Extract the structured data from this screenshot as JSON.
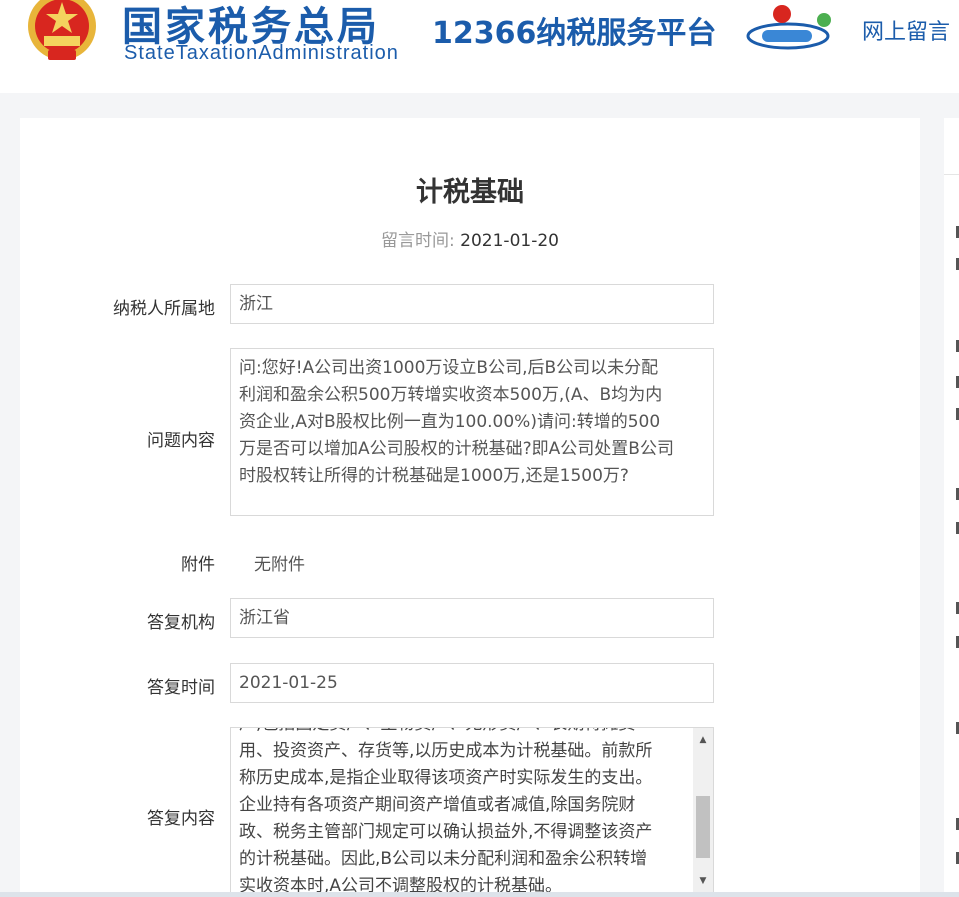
{
  "header": {
    "brand_cn": "国家税务总局",
    "brand_en": "StateTaxationAdministration",
    "platform": "12366纳税服务平台",
    "nav_link": "网上留言",
    "brand_color": "#1b5cab"
  },
  "page": {
    "title": "计税基础",
    "post_time_label": "留言时间:",
    "post_time_value": "2021-01-20"
  },
  "form": {
    "location_label": "纳税人所属地",
    "location_value": "浙江",
    "question_label": "问题内容",
    "question_lines": [
      "问:您好!A公司出资1000万设立B公司,后B公司以未分配",
      "利润和盈余公积500万转增实收资本500万,(A、B均为内",
      "资企业,A对B股权比例一直为100.00%)请问:转增的500",
      "万是否可以增加A公司股权的计税基础?即A公司处置B公司",
      "时股权转让所得的计税基础是1000万,还是1500万?"
    ],
    "attachment_label": "附件",
    "attachment_value": "无附件",
    "org_label": "答复机构",
    "org_value": "浙江省",
    "reply_time_label": "答复时间",
    "reply_time_value": "2021-01-25",
    "answer_label": "答复内容",
    "answer_lines": [
      "产,包括固定资产、生物资产、无形资产、长期待摊费",
      "用、投资资产、存货等,以历史成本为计税基础。前款所",
      "称历史成本,是指企业取得该项资产时实际发生的支出。",
      "企业持有各项资产期间资产增值或者减值,除国务院财",
      "政、税务主管部门规定可以确认损益外,不得调整该资产",
      "的计税基础。因此,B公司以未分配利润和盈余公积转增",
      "实收资本时,A公司不调整股权的计税基础。"
    ]
  },
  "icons": {
    "emblem": "national-emblem-icon",
    "logo": "12366-logo-icon",
    "scroll_up": "scroll-up-arrow-icon",
    "scroll_down": "scroll-down-arrow-icon"
  }
}
